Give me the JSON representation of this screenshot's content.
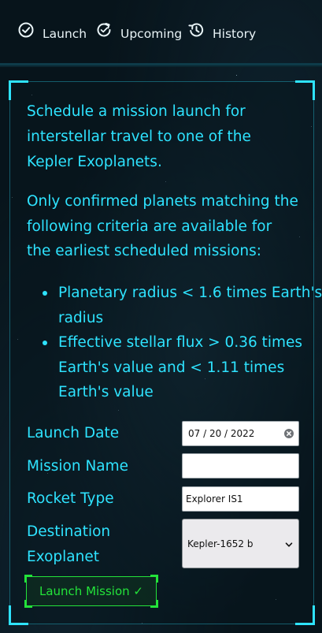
{
  "nav": {
    "items": [
      {
        "label": "Launch",
        "icon": "check-circle-icon"
      },
      {
        "label": "Upcoming",
        "icon": "refresh-icon"
      },
      {
        "label": "History",
        "icon": "history-icon"
      }
    ]
  },
  "intro": "Schedule a mission launch for interstellar travel to one of the Kepler Exoplanets.",
  "criteria": {
    "lead": "Only confirmed planets matching the following criteria are available for the earliest scheduled missions:",
    "items": [
      "Planetary radius < 1.6 times Earth's radius",
      "Effective stellar flux > 0.36 times Earth's value and < 1.11 times Earth's value"
    ]
  },
  "form": {
    "launch_date": {
      "label": "Launch Date",
      "value": "07 / 20 / 2022"
    },
    "mission_name": {
      "label": "Mission Name",
      "value": ""
    },
    "rocket_type": {
      "label": "Rocket Type",
      "value": "Explorer IS1"
    },
    "destination": {
      "label": "Destination Exoplanet",
      "value": "Kepler-1652 b"
    },
    "submit_label": "Launch Mission ✓"
  },
  "colors": {
    "accent": "#2ee3ff",
    "button": "#23e33a",
    "background": "#07141b"
  }
}
